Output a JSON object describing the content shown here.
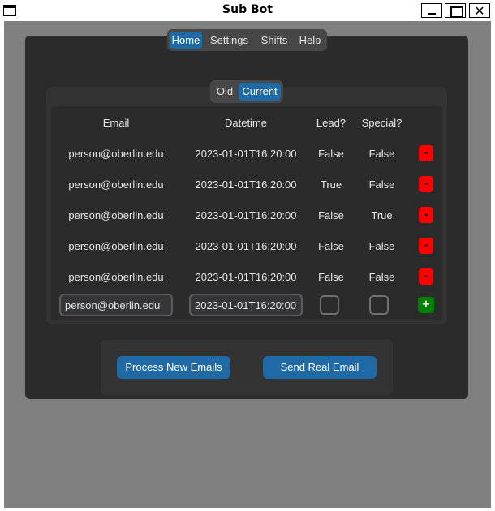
{
  "window": {
    "title": "Sub Bot",
    "close_glyph": "✕"
  },
  "nav": {
    "tabs": [
      {
        "label": "Home",
        "active": true
      },
      {
        "label": "Settings",
        "active": false
      },
      {
        "label": "Shifts",
        "active": false
      },
      {
        "label": "Help",
        "active": false
      }
    ]
  },
  "segment": {
    "options": [
      {
        "label": "Old",
        "active": false
      },
      {
        "label": "Current",
        "active": true
      }
    ]
  },
  "table": {
    "headers": {
      "email": "Email",
      "datetime": "Datetime",
      "lead": "Lead?",
      "special": "Special?"
    },
    "rows": [
      {
        "email": "person@oberlin.edu",
        "datetime": "2023-01-01T16:20:00",
        "lead": "False",
        "special": "False",
        "action": "-"
      },
      {
        "email": "person@oberlin.edu",
        "datetime": "2023-01-01T16:20:00",
        "lead": "True",
        "special": "False",
        "action": "-"
      },
      {
        "email": "person@oberlin.edu",
        "datetime": "2023-01-01T16:20:00",
        "lead": "False",
        "special": "True",
        "action": "-"
      },
      {
        "email": "person@oberlin.edu",
        "datetime": "2023-01-01T16:20:00",
        "lead": "False",
        "special": "False",
        "action": "-"
      },
      {
        "email": "person@oberlin.edu",
        "datetime": "2023-01-01T16:20:00",
        "lead": "False",
        "special": "False",
        "action": "-"
      }
    ],
    "new_row": {
      "email_value": "person@oberlin.edu",
      "datetime_value": "2023-01-01T16:20:00",
      "lead_checked": false,
      "special_checked": false,
      "add_label": "+"
    }
  },
  "actions": {
    "process_label": "Process New Emails",
    "send_label": "Send Real Email"
  },
  "colors": {
    "accent": "#1f6aa5",
    "delete": "#ff0000",
    "add": "#008000",
    "panel": "#2b2b2b",
    "background": "#808080"
  }
}
